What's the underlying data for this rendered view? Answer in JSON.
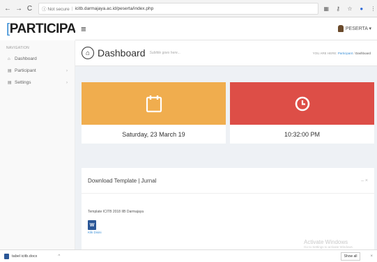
{
  "browser": {
    "back": "←",
    "forward": "→",
    "reload": "C",
    "security_label": "ⓘ Not secure",
    "url": "icitb.darmajaya.ac.id/peserta/index.php",
    "ext_icons": [
      "translate-icon",
      "key-icon",
      "star-icon",
      "extension-icon",
      "menu-icon"
    ]
  },
  "brand": {
    "open": "[",
    "name": "PARTICIPANT",
    "close": "]"
  },
  "topbar": {
    "menu_glyph": "≡",
    "user_label": "PESERTA ▾"
  },
  "sidebar": {
    "header": "NAVIGATION",
    "items": [
      {
        "label": "Dashboard",
        "icon": "home-icon"
      },
      {
        "label": "Participant",
        "icon": "document-icon",
        "chevron": "›"
      },
      {
        "label": "Settings",
        "icon": "document-icon",
        "chevron": "›"
      }
    ]
  },
  "pagehead": {
    "title": "Dashboard",
    "subtitle": "Subtitle goes here...",
    "breadcrumb_prefix": "YOU ARE HERE:",
    "breadcrumb_link": "Participant",
    "breadcrumb_sep": "/",
    "breadcrumb_current": "Dashboard"
  },
  "cards": {
    "date": {
      "label": "Saturday, 23 March 19",
      "color": "#f0ad4e"
    },
    "time": {
      "label": "10:32:00 PM",
      "color": "#dd4e47"
    }
  },
  "panel": {
    "title": "Download Template | Jurnal",
    "controls": "– ×",
    "template_name": "Template ICITB 2018 IIB Darmajaya",
    "file_icon_letter": "W",
    "download_link": "Klik Disini"
  },
  "watermark": {
    "line1": "Activate Windows",
    "line2": "Go to Settings to activate Windows."
  },
  "download_bar": {
    "filename": "tabel icitb.docx",
    "caret": "^",
    "show_all": "Show all",
    "close": "×"
  }
}
